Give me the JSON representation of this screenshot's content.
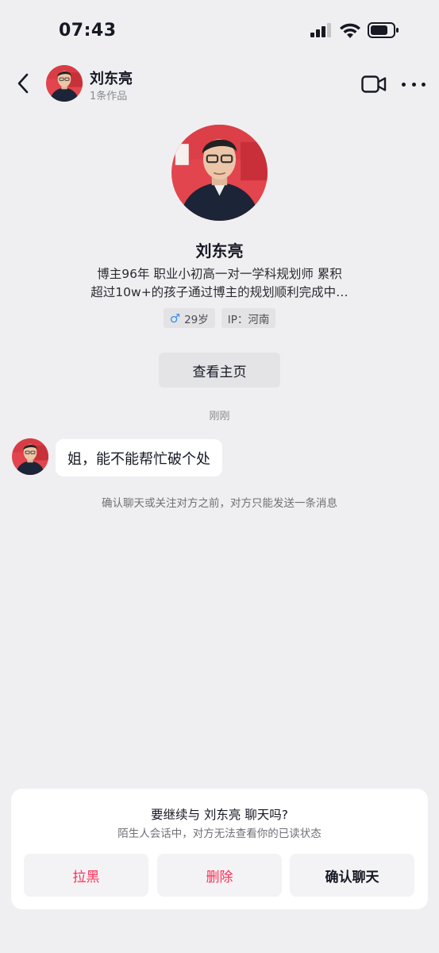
{
  "status_bar": {
    "time": "07:43"
  },
  "header": {
    "name": "刘东亮",
    "works": "1条作品"
  },
  "profile": {
    "name": "刘东亮",
    "bio_line1": "博主96年 职业小初高一对一学科规划师 累积",
    "bio_line2": "超过10w+的孩子通过博主的规划顺利完成中…",
    "age": "29岁",
    "ip": "IP：河南",
    "homepage_button": "查看主页"
  },
  "chat": {
    "timestamp": "刚刚",
    "message": "姐，能不能帮忙破个处",
    "notice": "确认聊天或关注对方之前，对方只能发送一条消息"
  },
  "sheet": {
    "title": "要继续与 刘东亮 聊天吗?",
    "subtitle": "陌生人会话中，对方无法查看你的已读状态",
    "block_label": "拉黑",
    "delete_label": "删除",
    "confirm_label": "确认聊天"
  },
  "colors": {
    "accent_red": "#fe2c55",
    "background": "#efeff1",
    "gender_blue": "#3c8ee8"
  },
  "icons": {
    "back": "chevron-left-icon",
    "video": "video-call-icon",
    "more": "more-icon",
    "gender": "male-icon",
    "signal": "signal-icon",
    "wifi": "wifi-icon",
    "battery": "battery-icon"
  }
}
